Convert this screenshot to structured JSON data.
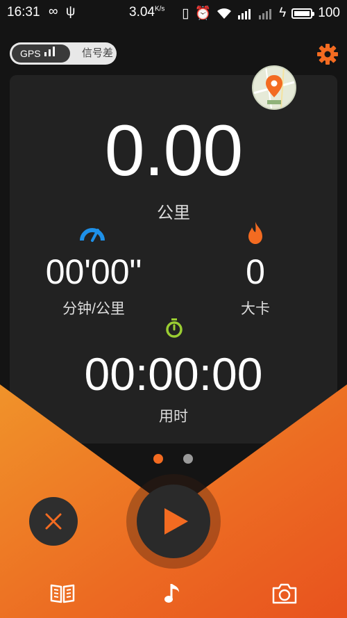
{
  "status_bar": {
    "time": "16:31",
    "network_speed": "3.04",
    "network_speed_unit": "K/s",
    "battery": "100"
  },
  "gps": {
    "label": "GPS",
    "signal_text": "信号差"
  },
  "distance": {
    "value": "0.00",
    "unit": "公里"
  },
  "pace": {
    "value": "00'00\"",
    "unit": "分钟/公里"
  },
  "calories": {
    "value": "0",
    "unit": "大卡"
  },
  "duration": {
    "value": "00:00:00",
    "unit": "用时"
  },
  "page_dots": {
    "count": 2,
    "active": 0
  },
  "icons": {
    "settings": "gear-icon",
    "map": "map-thumbnail",
    "pace": "speedometer-icon",
    "calories": "flame-icon",
    "duration": "stopwatch-icon",
    "close": "close-icon",
    "play": "play-icon",
    "book": "book-icon",
    "music": "music-note-icon",
    "camera": "camera-icon"
  },
  "colors": {
    "accent": "#f36b21",
    "pace_icon": "#1e90e8",
    "calories_icon": "#f36b21",
    "duration_icon": "#9acd32",
    "background": "#141414",
    "card": "#222222"
  }
}
